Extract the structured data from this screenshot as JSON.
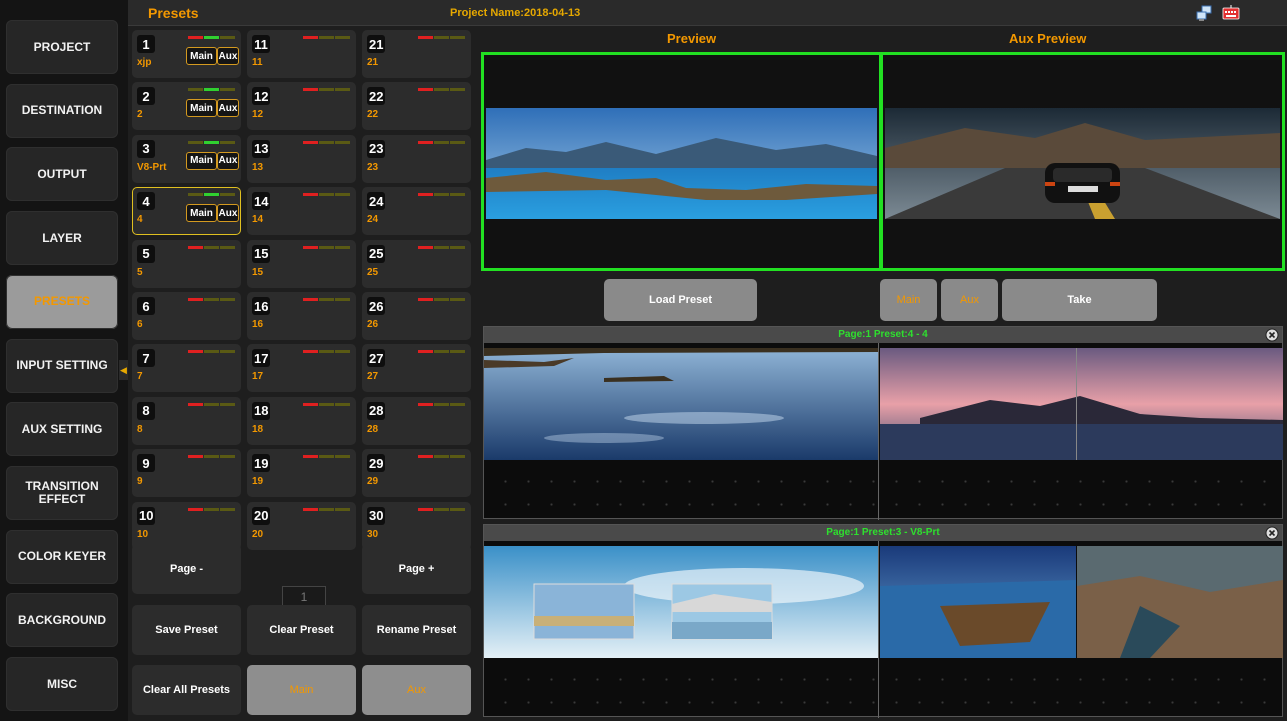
{
  "sidebar": {
    "items": [
      {
        "label": "PROJECT",
        "active": false
      },
      {
        "label": "DESTINATION",
        "active": false
      },
      {
        "label": "OUTPUT",
        "active": false
      },
      {
        "label": "LAYER",
        "active": false
      },
      {
        "label": "PRESETS",
        "active": true
      },
      {
        "label": "INPUT SETTING",
        "active": false
      },
      {
        "label": "AUX SETTING",
        "active": false
      },
      {
        "label": "TRANSITION\nEFFECT",
        "active": false
      },
      {
        "label": "COLOR KEYER",
        "active": false
      },
      {
        "label": "BACKGROUND",
        "active": false
      },
      {
        "label": "MISC",
        "active": false
      }
    ],
    "collapse_icon": "triangle-left-icon"
  },
  "header": {
    "title": "Presets",
    "project_name": "Project Name:2018-04-13",
    "icons": [
      "network-icon",
      "keyboard-icon"
    ]
  },
  "presets": {
    "tiles": [
      {
        "number": "1",
        "name": "xjp",
        "leds": [
          "red",
          "green",
          "olive"
        ],
        "tags": [
          "Main",
          "Aux"
        ],
        "selected": false
      },
      {
        "number": "2",
        "name": "2",
        "leds": [
          "olive",
          "green",
          "olive"
        ],
        "tags": [
          "Main",
          "Aux"
        ],
        "selected": false
      },
      {
        "number": "3",
        "name": "V8-Prt",
        "leds": [
          "olive",
          "green",
          "olive"
        ],
        "tags": [
          "Main",
          "Aux"
        ],
        "selected": false
      },
      {
        "number": "4",
        "name": "4",
        "leds": [
          "olive",
          "green",
          "olive"
        ],
        "tags": [
          "Main",
          "Aux"
        ],
        "selected": true
      },
      {
        "number": "5",
        "name": "5",
        "leds": [
          "red",
          "olive",
          "olive"
        ],
        "tags": [],
        "selected": false
      },
      {
        "number": "6",
        "name": "6",
        "leds": [
          "red",
          "olive",
          "olive"
        ],
        "tags": [],
        "selected": false
      },
      {
        "number": "7",
        "name": "7",
        "leds": [
          "red",
          "olive",
          "olive"
        ],
        "tags": [],
        "selected": false
      },
      {
        "number": "8",
        "name": "8",
        "leds": [
          "red",
          "olive",
          "olive"
        ],
        "tags": [],
        "selected": false
      },
      {
        "number": "9",
        "name": "9",
        "leds": [
          "red",
          "olive",
          "olive"
        ],
        "tags": [],
        "selected": false
      },
      {
        "number": "10",
        "name": "10",
        "leds": [
          "red",
          "olive",
          "olive"
        ],
        "tags": [],
        "selected": false
      },
      {
        "number": "11",
        "name": "11",
        "leds": [
          "red",
          "olive",
          "olive"
        ],
        "tags": [],
        "selected": false
      },
      {
        "number": "12",
        "name": "12",
        "leds": [
          "red",
          "olive",
          "olive"
        ],
        "tags": [],
        "selected": false
      },
      {
        "number": "13",
        "name": "13",
        "leds": [
          "red",
          "olive",
          "olive"
        ],
        "tags": [],
        "selected": false
      },
      {
        "number": "14",
        "name": "14",
        "leds": [
          "red",
          "olive",
          "olive"
        ],
        "tags": [],
        "selected": false
      },
      {
        "number": "15",
        "name": "15",
        "leds": [
          "red",
          "olive",
          "olive"
        ],
        "tags": [],
        "selected": false
      },
      {
        "number": "16",
        "name": "16",
        "leds": [
          "red",
          "olive",
          "olive"
        ],
        "tags": [],
        "selected": false
      },
      {
        "number": "17",
        "name": "17",
        "leds": [
          "red",
          "olive",
          "olive"
        ],
        "tags": [],
        "selected": false
      },
      {
        "number": "18",
        "name": "18",
        "leds": [
          "red",
          "olive",
          "olive"
        ],
        "tags": [],
        "selected": false
      },
      {
        "number": "19",
        "name": "19",
        "leds": [
          "red",
          "olive",
          "olive"
        ],
        "tags": [],
        "selected": false
      },
      {
        "number": "20",
        "name": "20",
        "leds": [
          "red",
          "olive",
          "olive"
        ],
        "tags": [],
        "selected": false
      },
      {
        "number": "21",
        "name": "21",
        "leds": [
          "red",
          "olive",
          "olive"
        ],
        "tags": [],
        "selected": false
      },
      {
        "number": "22",
        "name": "22",
        "leds": [
          "red",
          "olive",
          "olive"
        ],
        "tags": [],
        "selected": false
      },
      {
        "number": "23",
        "name": "23",
        "leds": [
          "red",
          "olive",
          "olive"
        ],
        "tags": [],
        "selected": false
      },
      {
        "number": "24",
        "name": "24",
        "leds": [
          "red",
          "olive",
          "olive"
        ],
        "tags": [],
        "selected": false
      },
      {
        "number": "25",
        "name": "25",
        "leds": [
          "red",
          "olive",
          "olive"
        ],
        "tags": [],
        "selected": false
      },
      {
        "number": "26",
        "name": "26",
        "leds": [
          "red",
          "olive",
          "olive"
        ],
        "tags": [],
        "selected": false
      },
      {
        "number": "27",
        "name": "27",
        "leds": [
          "red",
          "olive",
          "olive"
        ],
        "tags": [],
        "selected": false
      },
      {
        "number": "28",
        "name": "28",
        "leds": [
          "red",
          "olive",
          "olive"
        ],
        "tags": [],
        "selected": false
      },
      {
        "number": "29",
        "name": "29",
        "leds": [
          "red",
          "olive",
          "olive"
        ],
        "tags": [],
        "selected": false
      },
      {
        "number": "30",
        "name": "30",
        "leds": [
          "red",
          "olive",
          "olive"
        ],
        "tags": [],
        "selected": false
      }
    ],
    "page_minus": "Page -",
    "page_value": "1",
    "page_plus": "Page +",
    "save": "Save Preset",
    "clear": "Clear Preset",
    "rename": "Rename Preset",
    "clear_all": "Clear All Presets",
    "main": "Main",
    "aux": "Aux"
  },
  "preview": {
    "preview_label": "Preview",
    "aux_preview_label": "Aux Preview",
    "load_preset": "Load Preset",
    "main": "Main",
    "aux": "Aux",
    "take": "Take"
  },
  "cards": [
    {
      "title": "Page:1     Preset:4 - 4"
    },
    {
      "title": "Page:1     Preset:3 - V8-Prt"
    }
  ],
  "colors": {
    "accent": "#f39800",
    "preview_border": "#22e022",
    "card_title": "#2ee02e",
    "active_nav": "#9b9b9b"
  }
}
